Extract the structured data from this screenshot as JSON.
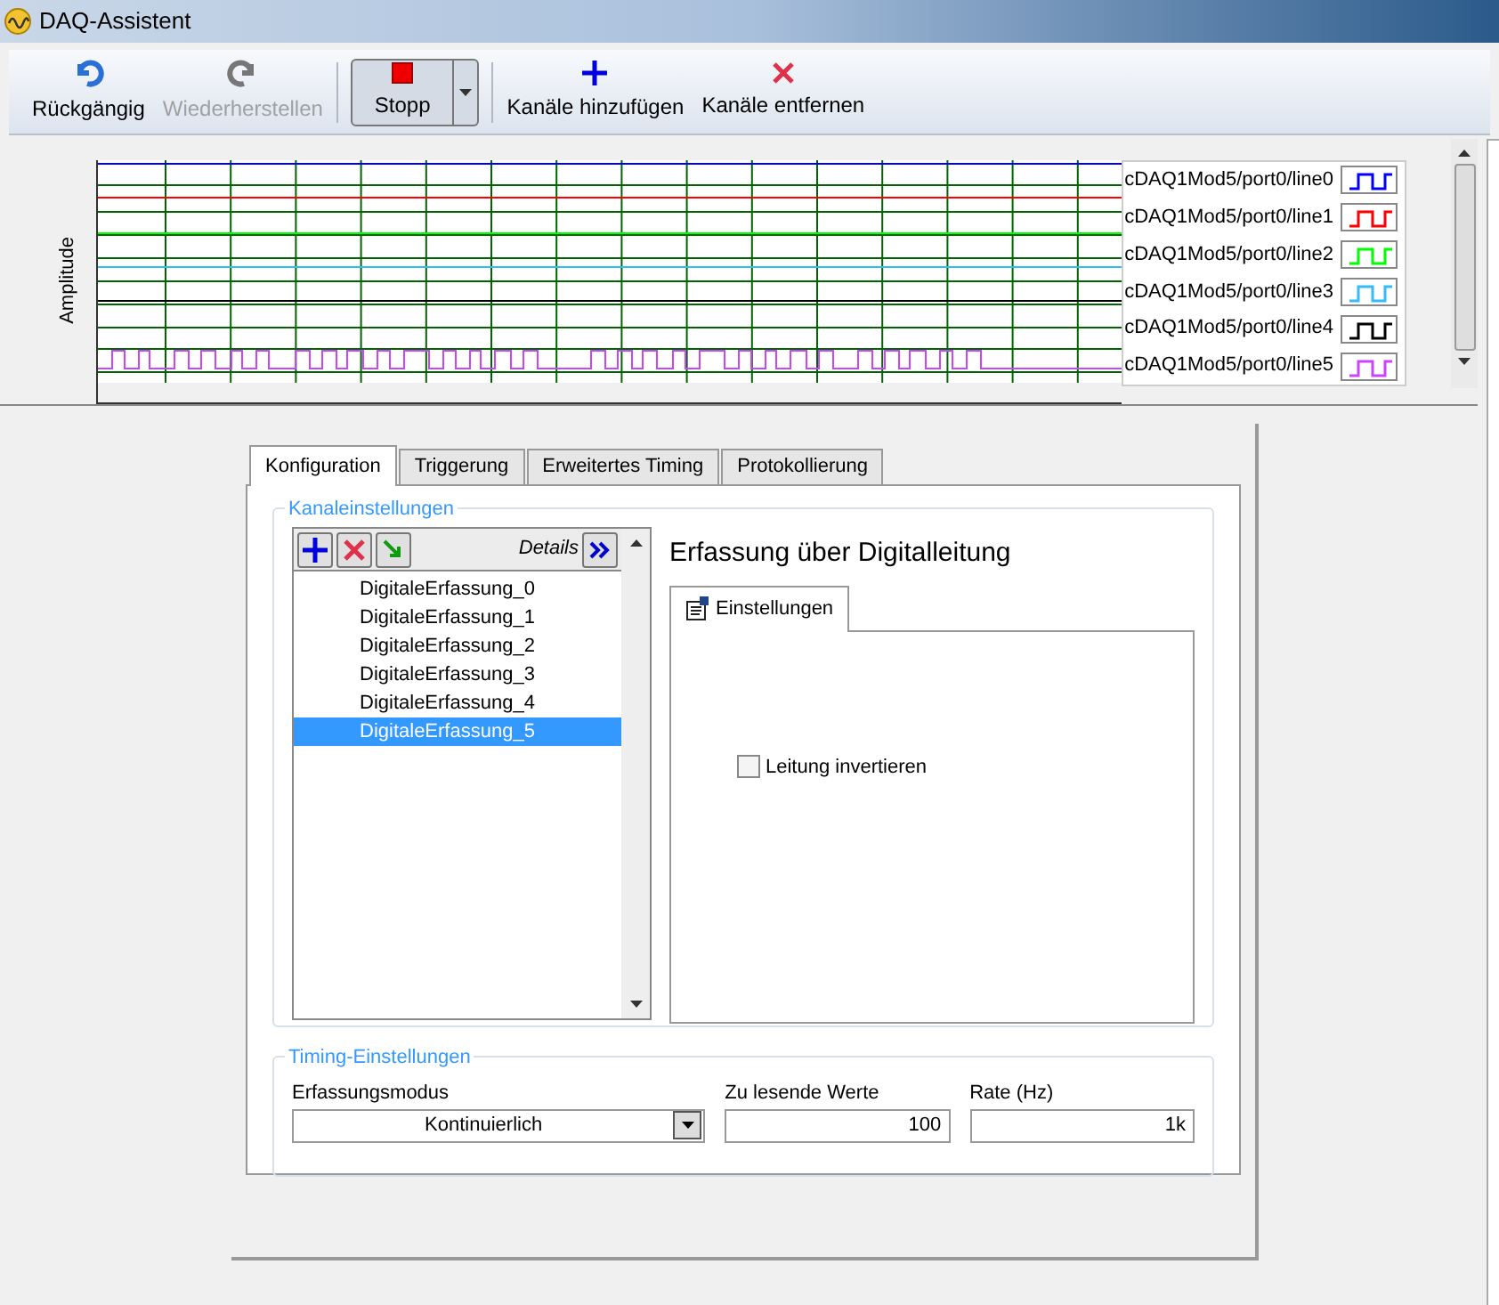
{
  "window": {
    "title": "DAQ-Assistent"
  },
  "toolbar": [
    {
      "kind": "undo",
      "label": "Rückgängig",
      "disabled": false
    },
    {
      "kind": "redo",
      "label": "Wiederherstellen",
      "disabled": true
    },
    {
      "kind": "stop",
      "label": "Stopp",
      "disabled": false
    },
    {
      "kind": "add",
      "label": "Kanäle hinzufügen",
      "disabled": false
    },
    {
      "kind": "remove",
      "label": "Kanäle entfernen",
      "disabled": false
    }
  ],
  "chart": {
    "y_label": "Amplitude",
    "legend": [
      {
        "name": "cDAQ1Mod5/port0/line0",
        "color": "#0000ff"
      },
      {
        "name": "cDAQ1Mod5/port0/line1",
        "color": "#ff0000"
      },
      {
        "name": "cDAQ1Mod5/port0/line2",
        "color": "#00ff00"
      },
      {
        "name": "cDAQ1Mod5/port0/line3",
        "color": "#33bbff"
      },
      {
        "name": "cDAQ1Mod5/port0/line4",
        "color": "#000000"
      },
      {
        "name": "cDAQ1Mod5/port0/line5",
        "color": "#cc44ff"
      }
    ]
  },
  "tabs": [
    {
      "label": "Konfiguration",
      "selected": true
    },
    {
      "label": "Triggerung",
      "selected": false
    },
    {
      "label": "Erweitertes Timing",
      "selected": false
    },
    {
      "label": "Protokollierung",
      "selected": false
    }
  ],
  "channel_settings": {
    "title": "Kanaleinstellungen",
    "details": "Details",
    "channels": [
      {
        "name": "DigitaleErfassung_0",
        "selected": false
      },
      {
        "name": "DigitaleErfassung_1",
        "selected": false
      },
      {
        "name": "DigitaleErfassung_2",
        "selected": false
      },
      {
        "name": "DigitaleErfassung_3",
        "selected": false
      },
      {
        "name": "DigitaleErfassung_4",
        "selected": false
      },
      {
        "name": "DigitaleErfassung_5",
        "selected": true
      }
    ],
    "panel_title": "Erfassung über Digitalleitung",
    "subtab": "Einstellungen",
    "invert": {
      "label": "Leitung invertieren",
      "checked": false
    }
  },
  "timing": {
    "title": "Timing-Einstellungen",
    "mode": {
      "label": "Erfassungsmodus",
      "value": "Kontinuierlich"
    },
    "samples": {
      "label": "Zu lesende Werte",
      "value": "100"
    },
    "rate": {
      "label": "Rate (Hz)",
      "value": "1k"
    }
  }
}
